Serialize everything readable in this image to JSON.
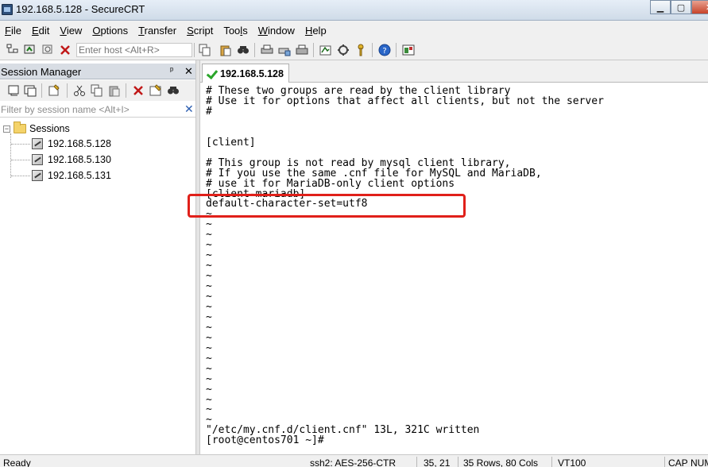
{
  "window": {
    "title": "192.168.5.128 - SecureCRT",
    "minimize": "▁",
    "maximize": "▢",
    "close": "✕"
  },
  "menu": {
    "items": [
      {
        "first": "F",
        "rest": "ile"
      },
      {
        "first": "E",
        "rest": "dit"
      },
      {
        "first": "V",
        "rest": "iew"
      },
      {
        "first": "O",
        "rest": "ptions"
      },
      {
        "first": "T",
        "rest": "ransfer"
      },
      {
        "first": "S",
        "rest": "cript"
      },
      {
        "first": "",
        "rest": "Tools",
        "under_index": 3
      },
      {
        "first": "W",
        "rest": "indow"
      },
      {
        "first": "H",
        "rest": "elp"
      }
    ]
  },
  "toolbar": {
    "host_placeholder": "Enter host <Alt+R>"
  },
  "session_manager": {
    "title": "Session Manager",
    "pin": "ᵖ",
    "close": "✕",
    "filter_placeholder": "Filter by session name <Alt+I>",
    "filter_clear": "✕",
    "root_label": "Sessions",
    "expander": "−",
    "sessions": [
      "192.168.5.128",
      "192.168.5.130",
      "192.168.5.131"
    ]
  },
  "tab": {
    "label": "192.168.5.128"
  },
  "terminal": {
    "lines": [
      "# These two groups are read by the client library",
      "# Use it for options that affect all clients, but not the server",
      "#",
      "",
      "",
      "[client]",
      "",
      "# This group is not read by mysql client library,",
      "# If you use the same .cnf file for MySQL and MariaDB,",
      "# use it for MariaDB-only client options",
      "[client-mariadb]",
      "default-character-set=utf8",
      "~",
      "~",
      "~",
      "~",
      "~",
      "~",
      "~",
      "~",
      "~",
      "~",
      "~",
      "~",
      "~",
      "~",
      "~",
      "~",
      "~",
      "~",
      "~",
      "~",
      "~",
      "\"/etc/my.cnf.d/client.cnf\" 13L, 321C written",
      "[root@centos701 ~]#"
    ]
  },
  "status": {
    "ready": "Ready",
    "cipher": "ssh2: AES-256-CTR",
    "cursor": "35, 21",
    "size": "35 Rows, 80 Cols",
    "emulation": "VT100",
    "cap": "CAP",
    "num": "NUM"
  },
  "colors": {
    "highlight_box": "#e0201a",
    "check": "#2aa52a"
  }
}
